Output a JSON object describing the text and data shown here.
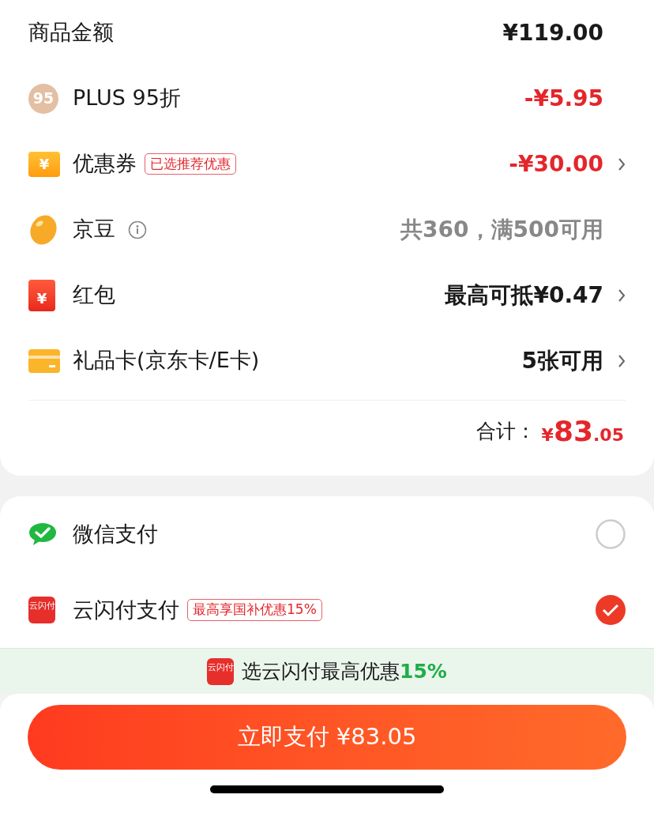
{
  "summary": {
    "rows": [
      {
        "kind": "subtotal",
        "label": "商品金额",
        "value": "¥119.00",
        "color": "#1a1a1a",
        "chevron": false,
        "info": false
      },
      {
        "kind": "plus",
        "label": "PLUS 95折",
        "icon_text": "95",
        "value": "-¥5.95",
        "color": "#e4262b",
        "chevron": false,
        "info": false
      },
      {
        "kind": "coupon",
        "label": "优惠券",
        "icon_text": "¥",
        "tag": "已选推荐优惠",
        "value": "-¥30.00",
        "color": "#e4262b",
        "chevron": true,
        "info": false
      },
      {
        "kind": "bean",
        "label": "京豆",
        "value": "共360，满500可用",
        "color": "#888888",
        "chevron": false,
        "info": true
      },
      {
        "kind": "redpacket",
        "label": "红包",
        "icon_text": "¥",
        "value": "最高可抵¥0.47",
        "color": "#1a1a1a",
        "chevron": true,
        "info": false
      },
      {
        "kind": "giftcard",
        "label": "礼品卡(京东卡/E卡)",
        "value": "5张可用",
        "color": "#1a1a1a",
        "chevron": true,
        "info": false
      }
    ],
    "total": {
      "label": "合计：",
      "currency": "¥",
      "integer": "83",
      "decimals": ".05"
    }
  },
  "payment": {
    "methods": [
      {
        "kind": "wechat",
        "label": "微信支付",
        "selected": false
      },
      {
        "kind": "unionpay",
        "label": "云闪付支付",
        "icon_text": "云闪付",
        "tag": "最高享国补优惠15%",
        "selected": true
      }
    ]
  },
  "banner": {
    "icon_text": "云闪付",
    "text": "选云闪付最高优惠",
    "highlight": "15%"
  },
  "pay_button": "立即支付 ¥83.05"
}
